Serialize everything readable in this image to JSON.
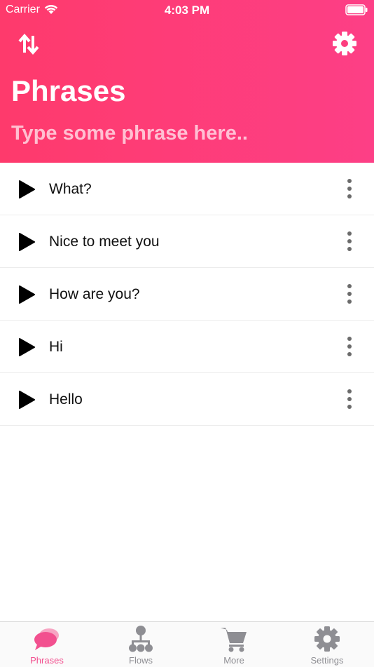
{
  "status_bar": {
    "carrier": "Carrier",
    "time": "4:03 PM"
  },
  "header": {
    "title": "Phrases",
    "input_placeholder": "Type some phrase here..",
    "input_value": ""
  },
  "phrases": [
    "What?",
    "Nice to meet you",
    "How are you?",
    "Hi",
    "Hello"
  ],
  "tabs": [
    {
      "label": "Phrases",
      "icon": "chat-bubbles-icon",
      "active": true
    },
    {
      "label": "Flows",
      "icon": "hierarchy-icon",
      "active": false
    },
    {
      "label": "More",
      "icon": "cart-icon",
      "active": false
    },
    {
      "label": "Settings",
      "icon": "gear-icon",
      "active": false
    }
  ],
  "colors": {
    "header_start": "#fe3a6c",
    "header_end": "#fd3f86",
    "active_tab": "#f2508f",
    "inactive_tab": "#8e8e93"
  }
}
